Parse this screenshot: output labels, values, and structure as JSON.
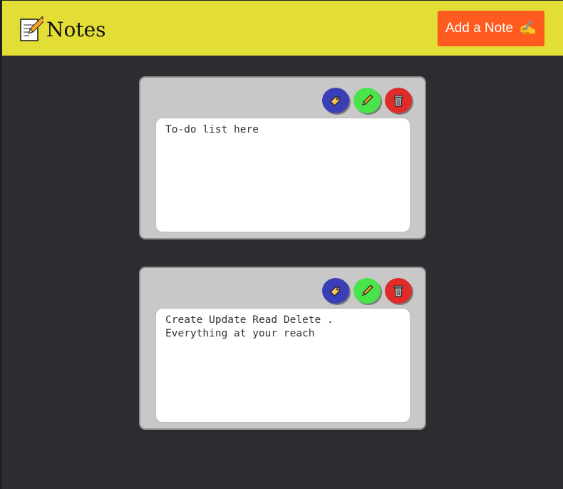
{
  "header": {
    "title": "Notes",
    "logo_icon": "memo-icon",
    "add_button_label": "Add a Note",
    "add_button_icon": "writing-hand-icon",
    "add_button_color": "#ff5a1f",
    "background_color": "#e3de35"
  },
  "notes": [
    {
      "text": "To-do list here",
      "actions": [
        "tag-icon",
        "pencil-icon",
        "trash-icon"
      ]
    },
    {
      "text": "Create Update Read Delete .\nEverything at your reach",
      "actions": [
        "tag-icon",
        "pencil-icon",
        "trash-icon"
      ]
    }
  ],
  "colors": {
    "page_background": "#2c2d30",
    "card_background": "#c8c8c8",
    "tag_button": "#3a3fb8",
    "edit_button": "#48e44a",
    "delete_button": "#e02b2b"
  }
}
